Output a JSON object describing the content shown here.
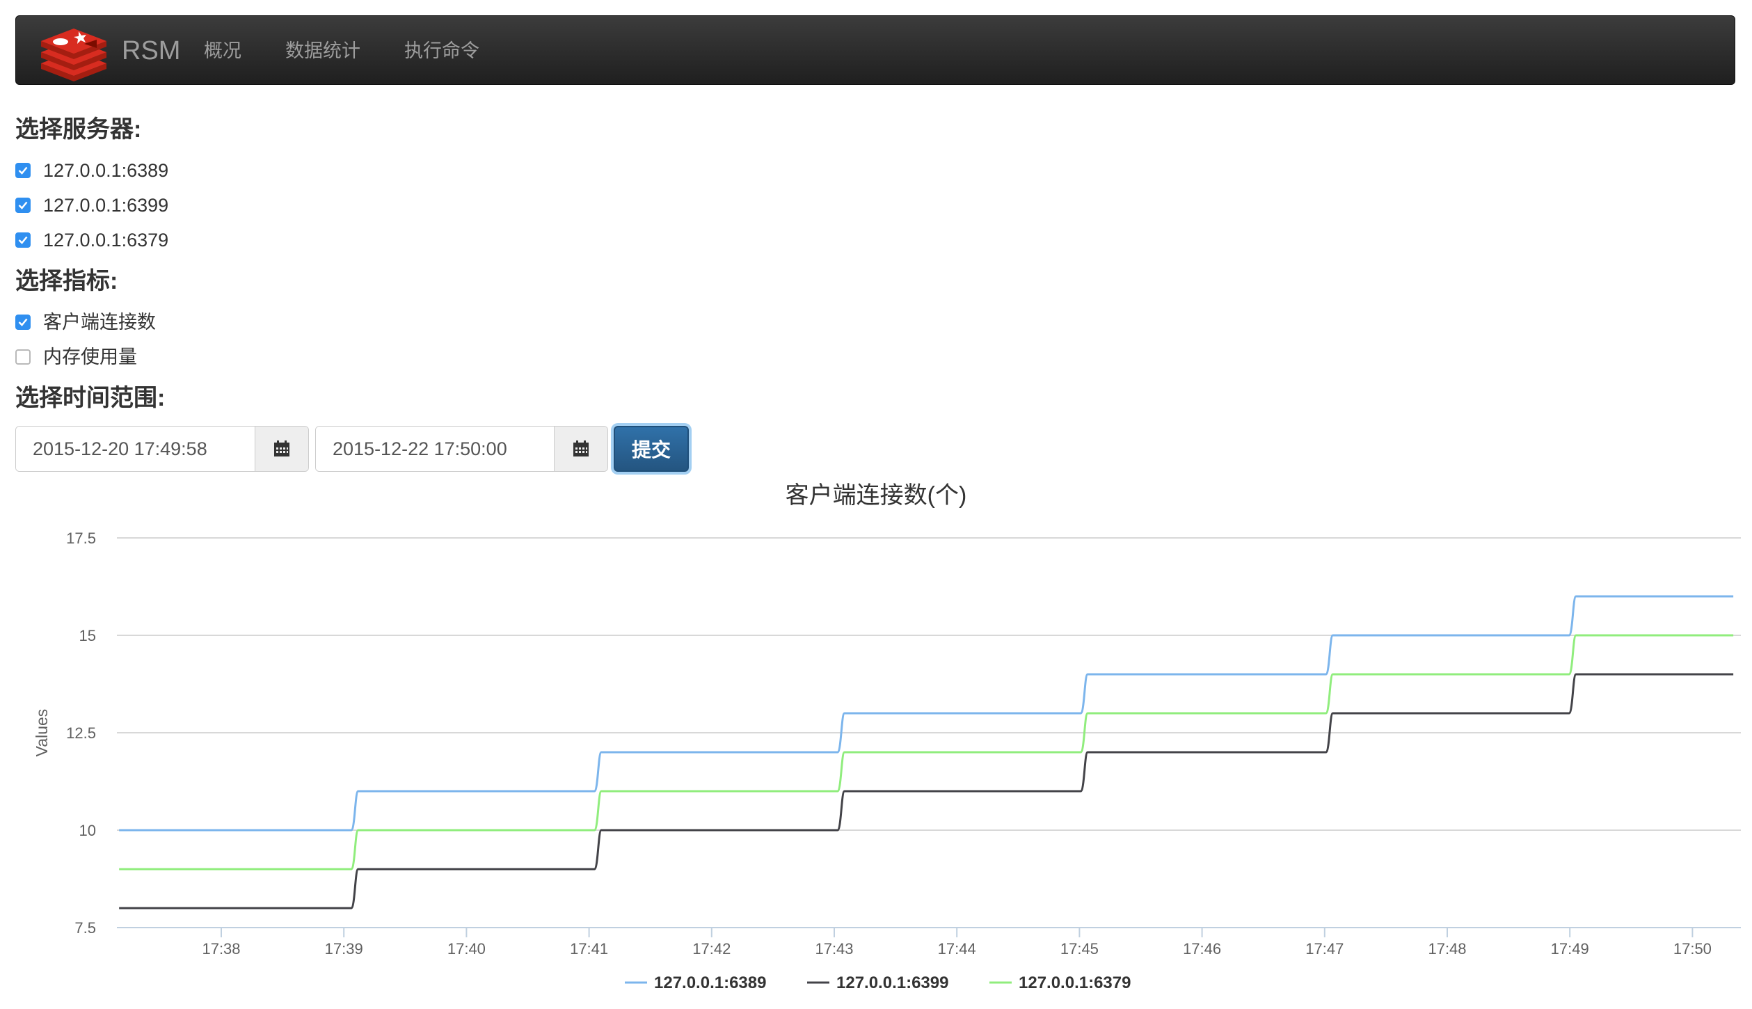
{
  "navbar": {
    "brand": "RSM",
    "items": [
      "概况",
      "数据统计",
      "执行命令"
    ]
  },
  "servers": {
    "title": "选择服务器:",
    "items": [
      {
        "label": "127.0.0.1:6389",
        "checked": true
      },
      {
        "label": "127.0.0.1:6399",
        "checked": true
      },
      {
        "label": "127.0.0.1:6379",
        "checked": true
      }
    ]
  },
  "metrics": {
    "title": "选择指标:",
    "items": [
      {
        "label": "客户端连接数",
        "checked": true
      },
      {
        "label": "内存使用量",
        "checked": false
      }
    ]
  },
  "time_range": {
    "title": "选择时间范围:",
    "start": "2015-12-20 17:49:58",
    "end": "2015-12-22 17:50:00",
    "calendar_icon": "calendar-icon",
    "submit_label": "提交"
  },
  "colors": {
    "series_6389": "#7cb5ec",
    "series_6399": "#434348",
    "series_6379": "#90ed7d",
    "submit": "#286090"
  },
  "chart_data": {
    "type": "line",
    "title": "客户端连接数(个)",
    "ylabel": "Values",
    "xlabel": "",
    "ylim": [
      7.5,
      17.5
    ],
    "yticks": [
      7.5,
      10,
      12.5,
      15,
      17.5
    ],
    "xticks": [
      "17:38",
      "17:39",
      "17:40",
      "17:41",
      "17:42",
      "17:43",
      "17:44",
      "17:45",
      "17:46",
      "17:47",
      "17:48",
      "17:49",
      "17:50"
    ],
    "step_times": [
      "17:37:10",
      "17:39:07",
      "17:41:06",
      "17:43:05",
      "17:45:04",
      "17:47:04",
      "17:49:03",
      "17:50:20"
    ],
    "series": [
      {
        "name": "127.0.0.1:6389",
        "color": "#7cb5ec",
        "values": [
          10,
          11,
          12,
          13,
          14,
          15,
          16,
          16
        ]
      },
      {
        "name": "127.0.0.1:6399",
        "color": "#434348",
        "values": [
          8,
          9,
          10,
          11,
          12,
          13,
          14,
          14
        ]
      },
      {
        "name": "127.0.0.1:6379",
        "color": "#90ed7d",
        "values": [
          9,
          10,
          11,
          12,
          13,
          14,
          15,
          15
        ]
      }
    ],
    "grid": true,
    "legend_position": "bottom-center"
  }
}
